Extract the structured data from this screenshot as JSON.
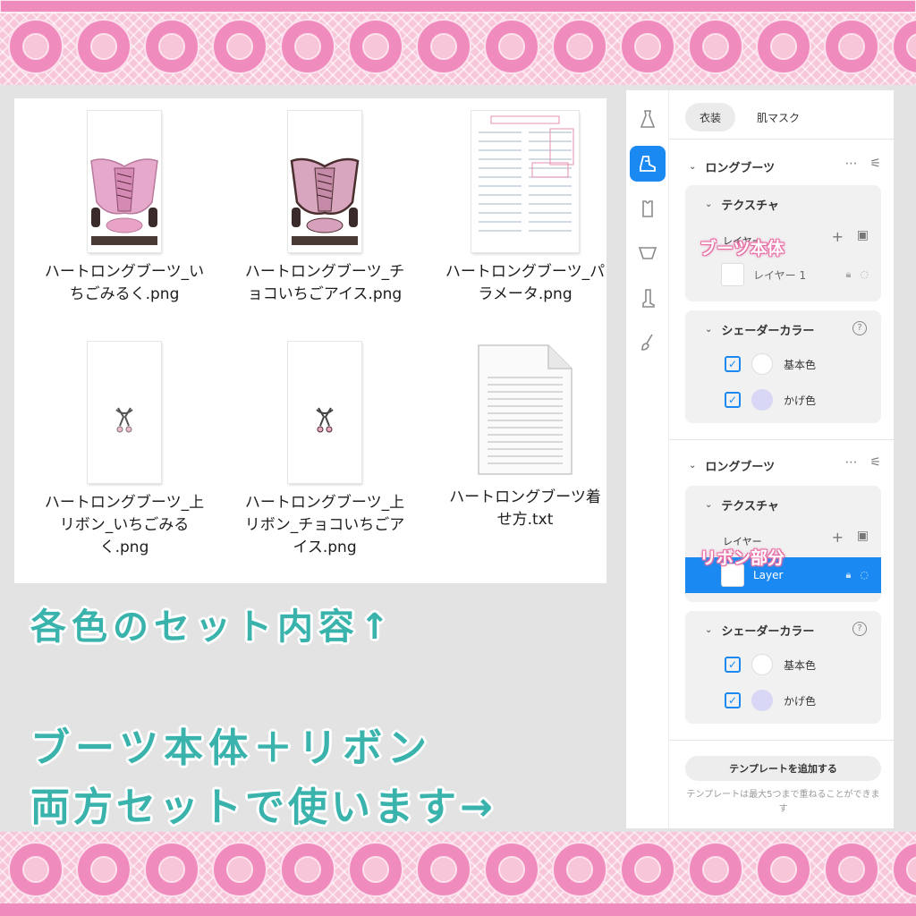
{
  "files": [
    {
      "name": "ハートロングブーツ_いちごみるく.png",
      "icon": "boots-pink-thumbnail"
    },
    {
      "name": "ハートロングブーツ_チョコいちごアイス.png",
      "icon": "boots-choco-thumbnail"
    },
    {
      "name": "ハートロングブーツ_パラメータ.png",
      "icon": "parameter-sheet-thumbnail"
    },
    {
      "name": "ハートロングブーツ_上リボン_いちごみるく.png",
      "icon": "ribbon-thumbnail"
    },
    {
      "name": "ハートロングブーツ_上リボン_チョコいちごアイス.png",
      "icon": "ribbon-thumbnail"
    },
    {
      "name": "ハートロングブーツ着せ方.txt",
      "icon": "text-file-icon"
    }
  ],
  "captions": {
    "set_contents": "各色のセット内容↑",
    "usage_line1": "ブーツ本体＋リボン",
    "usage_line2": "両方セットで使います→"
  },
  "panel": {
    "tabs": [
      {
        "label": "衣装",
        "active": true
      },
      {
        "label": "肌マスク",
        "active": false
      }
    ],
    "sidebar_icons": [
      "dress-icon",
      "shoe-icon",
      "top-icon",
      "bottom-icon",
      "sock-icon",
      "brush-icon"
    ],
    "sections": [
      {
        "title": "ロングブーツ",
        "texture_title": "テクスチャ",
        "layer_label": "レイヤー",
        "layer_name": "レイヤー 1",
        "overlay": "ブーツ本体",
        "shader_title": "シェーダーカラー",
        "colors": [
          {
            "label": "基本色",
            "color": "#ffffff"
          },
          {
            "label": "かげ色",
            "color": "#d8d8f6"
          }
        ]
      },
      {
        "title": "ロングブーツ",
        "texture_title": "テクスチャ",
        "layer_label": "レイヤー",
        "layer_name": "Layer",
        "overlay": "リボン部分",
        "shader_title": "シェーダーカラー",
        "colors": [
          {
            "label": "基本色",
            "color": "#ffffff"
          },
          {
            "label": "かげ色",
            "color": "#d8d8f6"
          }
        ]
      }
    ],
    "template_button": "テンプレートを追加する",
    "template_note": "テンプレートは最大5つまで重ねることができます"
  },
  "colors": {
    "accent": "#1a8af2",
    "caption": "#3ab3ac",
    "lace": "#f08cbd"
  }
}
